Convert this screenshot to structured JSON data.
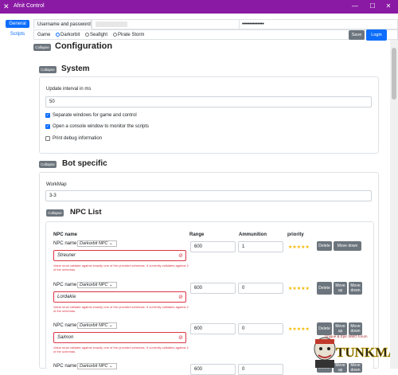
{
  "window": {
    "title": "Afnit Control",
    "minimize": "—",
    "maximize": "☐",
    "close": "✕",
    "icon": "x-logo-icon"
  },
  "sidebar": {
    "items": [
      {
        "label": "General"
      },
      {
        "label": "Scripts"
      }
    ]
  },
  "tabs": {
    "active": "General",
    "login_tab": "Username and password"
  },
  "credentials": {
    "password_mask": "••••••••••••••"
  },
  "game": {
    "label": "Game",
    "options": [
      "Darkorbit",
      "Seafight",
      "Pirate Storm"
    ],
    "selected": "Darkorbit"
  },
  "toolbar": {
    "save": "Save",
    "login": "Login"
  },
  "configuration": {
    "collapse": "Collapse",
    "title": "Configuration"
  },
  "system": {
    "collapse": "Collapse",
    "title": "System",
    "update_label": "Update interval in ms",
    "update_value": "50",
    "options": [
      {
        "label": "Separate windows for game and control",
        "checked": true
      },
      {
        "label": "Open a console window to monitor the scripts",
        "checked": true
      },
      {
        "label": "Print debug information",
        "checked": false
      }
    ]
  },
  "bot": {
    "collapse": "Collapse",
    "title": "Bot specific",
    "workmap_label": "WorkMap",
    "workmap_value": "3-3"
  },
  "npc_list": {
    "collapse": "Collapse",
    "title": "NPC List",
    "columns": {
      "name": "NPC name",
      "range": "Range",
      "ammo": "Ammunition",
      "priority": "priority"
    },
    "rows": [
      {
        "name_label": "NPC name",
        "type": "Darkorbit NPC",
        "name": "Streuner",
        "error": "Value must validate against exactly one of the provided schemas. It currently validates against 2 of the schemas.",
        "range": "600",
        "ammo": "1",
        "stars": "★★★★★",
        "delete": "Delete",
        "move_down": "Move down"
      },
      {
        "name_label": "NPC name",
        "type": "Darkorbit NPC",
        "name": "Lordakia",
        "error": "Value must validate against exactly one of the provided schemas. It currently validates against 2 of the schemas.",
        "range": "600",
        "ammo": "0",
        "stars": "★★★★★",
        "delete": "Delete",
        "move_up": "Move up",
        "move_down": "Move down"
      },
      {
        "name_label": "NPC name",
        "type": "Darkorbit NPC",
        "name": "Saimon",
        "error": "Value must validate against exactly one of the provided schemas. It currently validates against 2 of the schemas.",
        "range": "600",
        "ammo": "0",
        "stars": "★★★★★",
        "delete": "Delete",
        "move_up": "Move up",
        "move_down": "Move down"
      },
      {
        "name_label": "NPC name",
        "type": "Darkorbit NPC",
        "range": "600",
        "ammo": "0",
        "delete": "Delete",
        "move_up": "Move up",
        "move_down": "Move down"
      }
    ]
  },
  "watermark": {
    "brand": "TUNKMAP",
    "tagline": "Unique & Epic MMO forum"
  },
  "colors": {
    "titlebar": "#8a1aa4",
    "primary": "#0d6efd",
    "secondary": "#6c757d",
    "error": "#dc3545",
    "star": "#f5b800"
  }
}
